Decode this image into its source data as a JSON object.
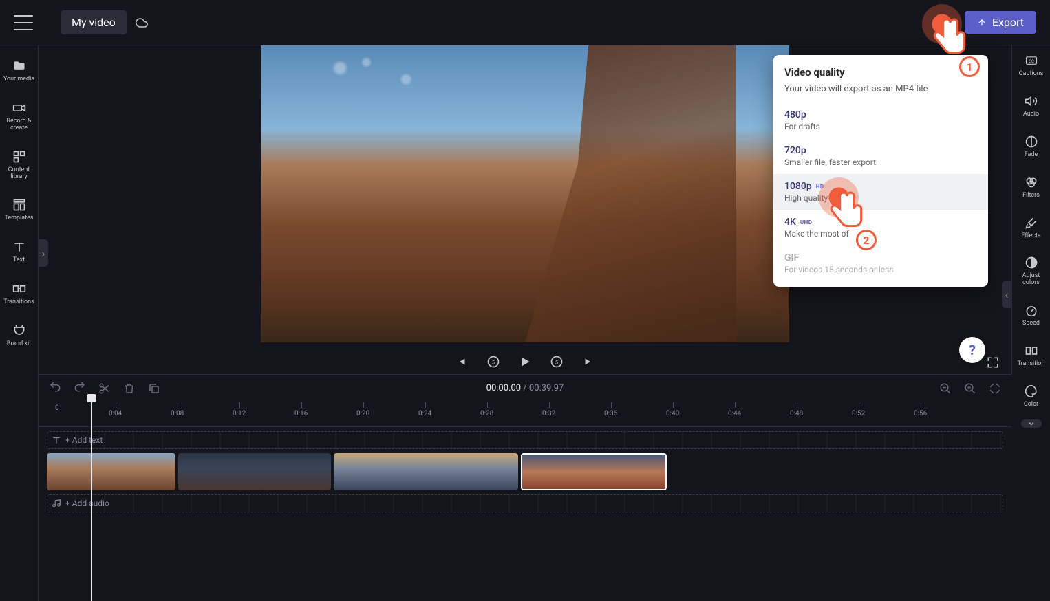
{
  "header": {
    "video_title": "My video",
    "export_label": "Export"
  },
  "left_sidebar": [
    {
      "label": "Your media"
    },
    {
      "label": "Record & create"
    },
    {
      "label": "Content library"
    },
    {
      "label": "Templates"
    },
    {
      "label": "Text"
    },
    {
      "label": "Transitions"
    },
    {
      "label": "Brand kit"
    }
  ],
  "right_sidebar": [
    {
      "label": "Captions"
    },
    {
      "label": "Audio"
    },
    {
      "label": "Fade"
    },
    {
      "label": "Filters"
    },
    {
      "label": "Effects"
    },
    {
      "label": "Adjust colors"
    },
    {
      "label": "Speed"
    },
    {
      "label": "Transition"
    },
    {
      "label": "Color"
    }
  ],
  "export_popover": {
    "title": "Video quality",
    "subtitle": "Your video will export as an MP4 file",
    "options": [
      {
        "title": "480p",
        "desc": "For drafts",
        "badge": ""
      },
      {
        "title": "720p",
        "desc": "Smaller file, faster export",
        "badge": ""
      },
      {
        "title": "1080p",
        "desc": "High quality",
        "badge": "HD"
      },
      {
        "title": "4K",
        "desc": "Make the most of",
        "badge": "UHD"
      },
      {
        "title": "GIF",
        "desc": "For videos 15 seconds or less",
        "badge": ""
      }
    ]
  },
  "annotations": {
    "step1": "1",
    "step2": "2"
  },
  "timeline": {
    "current_time": "00:00.00",
    "total_time": "00:39.97",
    "separator": " / ",
    "ruler_start": "0",
    "marks": [
      "0:04",
      "0:08",
      "0:12",
      "0:16",
      "0:20",
      "0:24",
      "0:28",
      "0:32",
      "0:36",
      "0:40",
      "0:44",
      "0:48",
      "0:52",
      "0:56"
    ],
    "add_text": "+ Add text",
    "add_audio": "+ Add audio"
  }
}
